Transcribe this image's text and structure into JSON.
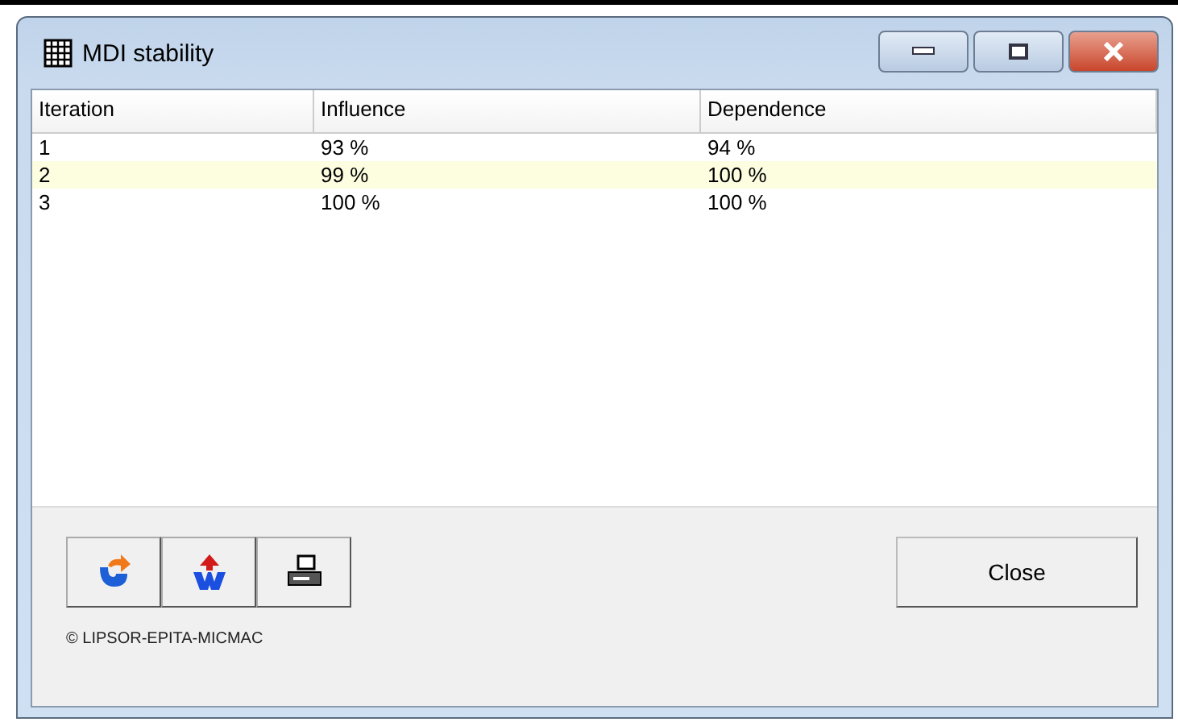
{
  "window": {
    "title": "MDI stability"
  },
  "table": {
    "columns": [
      "Iteration",
      "Influence",
      "Dependence"
    ],
    "rows": [
      {
        "cells": [
          "1",
          "93 %",
          "94 %"
        ],
        "selected": false
      },
      {
        "cells": [
          "2",
          "99 %",
          "100 %"
        ],
        "selected": true
      },
      {
        "cells": [
          "3",
          "100 %",
          "100 %"
        ],
        "selected": false
      }
    ]
  },
  "toolbar": [
    {
      "kind": "refresh"
    },
    {
      "kind": "export"
    },
    {
      "kind": "print"
    }
  ],
  "close_button": "Close",
  "footer": "© LIPSOR-EPITA-MICMAC"
}
